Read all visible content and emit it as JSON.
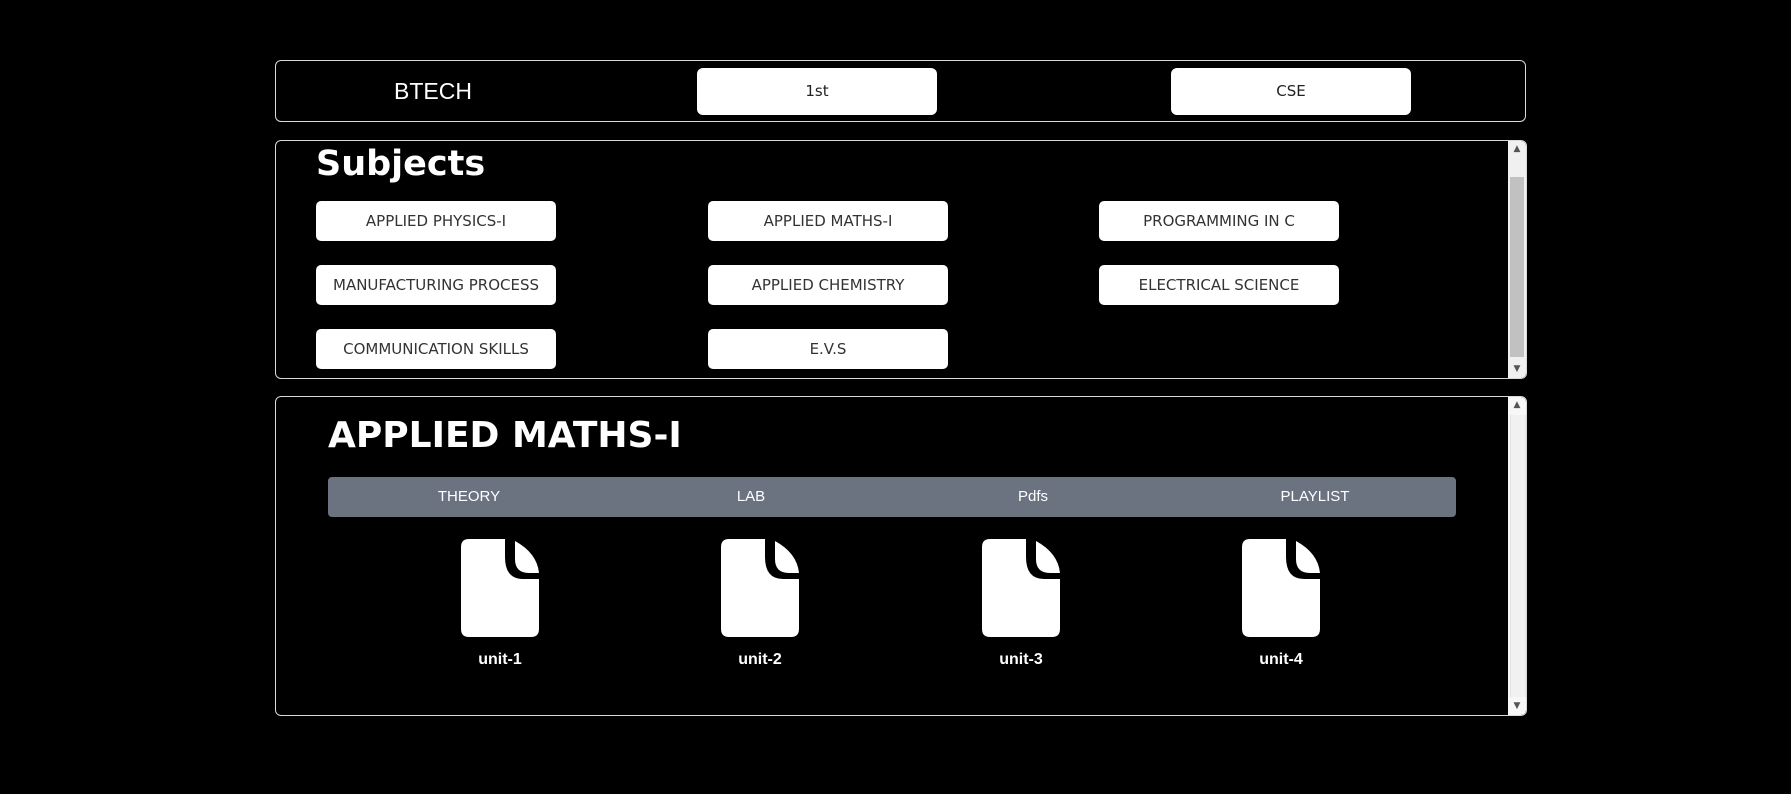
{
  "topbar": {
    "course": "BTECH",
    "year": "1st",
    "branch": "CSE"
  },
  "subjects": {
    "title": "Subjects",
    "items": [
      "APPLIED PHYSICS-I",
      "APPLIED MATHS-I",
      "PROGRAMMING IN C",
      "MANUFACTURING PROCESS",
      "APPLIED CHEMISTRY",
      "ELECTRICAL SCIENCE",
      "COMMUNICATION SKILLS",
      "E.V.S"
    ]
  },
  "detail": {
    "title": "APPLIED MATHS-I",
    "tabs": [
      "THEORY",
      "LAB",
      "Pdfs",
      "PLAYLIST"
    ],
    "units": [
      {
        "label": "unit-1",
        "icon": "file-icon"
      },
      {
        "label": "unit-2",
        "icon": "file-icon"
      },
      {
        "label": "unit-3",
        "icon": "file-icon"
      },
      {
        "label": "unit-4",
        "icon": "file-icon"
      }
    ]
  }
}
